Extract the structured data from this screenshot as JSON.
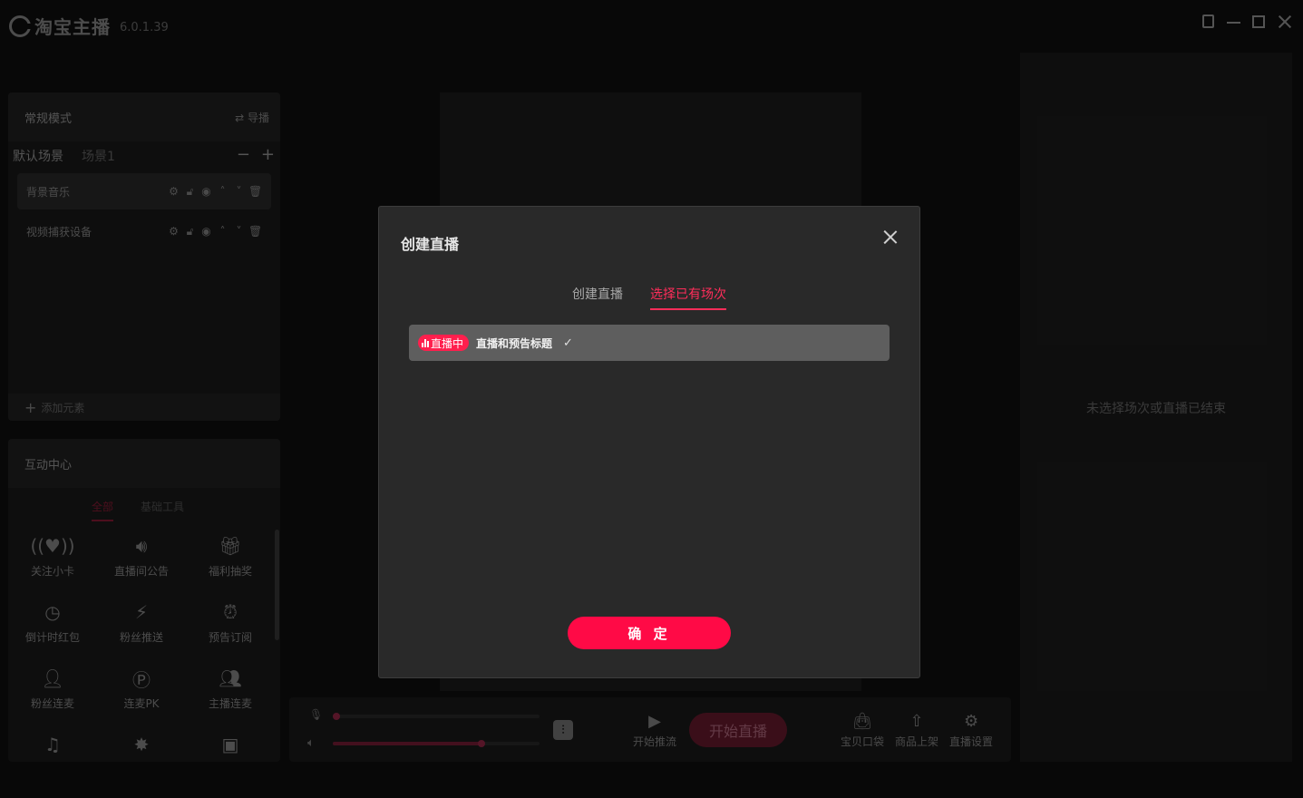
{
  "app": {
    "title": "淘宝主播",
    "version": "6.0.1.39"
  },
  "scene_panel": {
    "mode_label": "常规模式",
    "switch_label": "⇄ 导播",
    "tabs": [
      "默认场景",
      "场景1"
    ],
    "sources": [
      {
        "name": "背景音乐",
        "selected": true
      },
      {
        "name": "视频捕获设备",
        "selected": false
      }
    ],
    "add_element_label": "添加元素"
  },
  "interaction_panel": {
    "title": "互动中心",
    "tabs": [
      "全部",
      "基础工具"
    ],
    "tools": [
      {
        "label": "关注小卡",
        "icon": "follow-card-icon"
      },
      {
        "label": "直播间公告",
        "icon": "speaker-icon"
      },
      {
        "label": "福利抽奖",
        "icon": "gift-icon"
      },
      {
        "label": "倒计时红包",
        "icon": "timer-icon"
      },
      {
        "label": "粉丝推送",
        "icon": "push-icon"
      },
      {
        "label": "预告订阅",
        "icon": "alarm-icon"
      },
      {
        "label": "粉丝连麦",
        "icon": "fan-link-icon"
      },
      {
        "label": "连麦PK",
        "icon": "pk-icon"
      },
      {
        "label": "主播连麦",
        "icon": "host-link-icon"
      }
    ]
  },
  "bottom_bar": {
    "mic_level": 0.0,
    "speaker_level": 0.72,
    "push_stream_label": "开始推流",
    "start_live_label": "开始直播",
    "tools": [
      {
        "label": "宝贝口袋",
        "icon": "bag-icon"
      },
      {
        "label": "商品上架",
        "icon": "upload-icon"
      },
      {
        "label": "直播设置",
        "icon": "gear-icon"
      }
    ]
  },
  "right_panel": {
    "message": "未选择场次或直播已结束"
  },
  "modal": {
    "title": "创建直播",
    "tabs": [
      "创建直播",
      "选择已有场次"
    ],
    "active_tab": 1,
    "session": {
      "badge": "直播中",
      "title": "直播和预告标题"
    },
    "confirm_label": "确 定"
  },
  "colors": {
    "accent": "#ff0a46",
    "tab_active": "#ff2d5a"
  }
}
